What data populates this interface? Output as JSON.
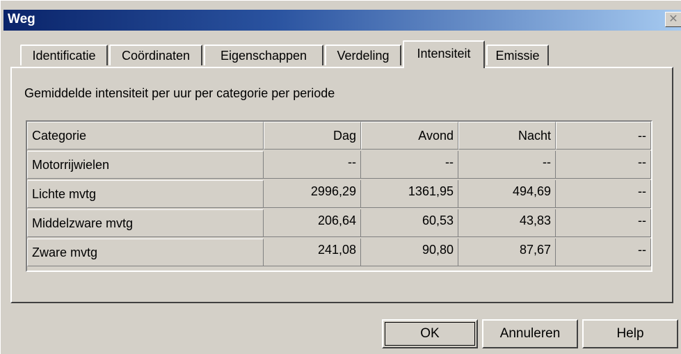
{
  "window": {
    "title": "Weg",
    "close_glyph": "✕"
  },
  "tabs": [
    {
      "label": "Identificatie",
      "active": false
    },
    {
      "label": "Coördinaten",
      "active": false
    },
    {
      "label": "Eigenschappen",
      "active": false
    },
    {
      "label": "Verdeling",
      "active": false
    },
    {
      "label": "Intensiteit",
      "active": true
    },
    {
      "label": "Emissie",
      "active": false
    }
  ],
  "panel": {
    "description": "Gemiddelde intensiteit per uur per categorie per periode"
  },
  "table": {
    "columns": [
      "Categorie",
      "Dag",
      "Avond",
      "Nacht",
      "--"
    ],
    "rows": [
      {
        "category": "Motorrijwielen",
        "dag": "--",
        "avond": "--",
        "nacht": "--",
        "extra": "--"
      },
      {
        "category": "Lichte mvtg",
        "dag": "2996,29",
        "avond": "1361,95",
        "nacht": "494,69",
        "extra": "--"
      },
      {
        "category": "Middelzware mvtg",
        "dag": "206,64",
        "avond": "60,53",
        "nacht": "43,83",
        "extra": "--"
      },
      {
        "category": "Zware mvtg",
        "dag": "241,08",
        "avond": "90,80",
        "nacht": "87,67",
        "extra": "--"
      }
    ]
  },
  "buttons": {
    "ok": "OK",
    "cancel": "Annuleren",
    "help": "Help"
  }
}
